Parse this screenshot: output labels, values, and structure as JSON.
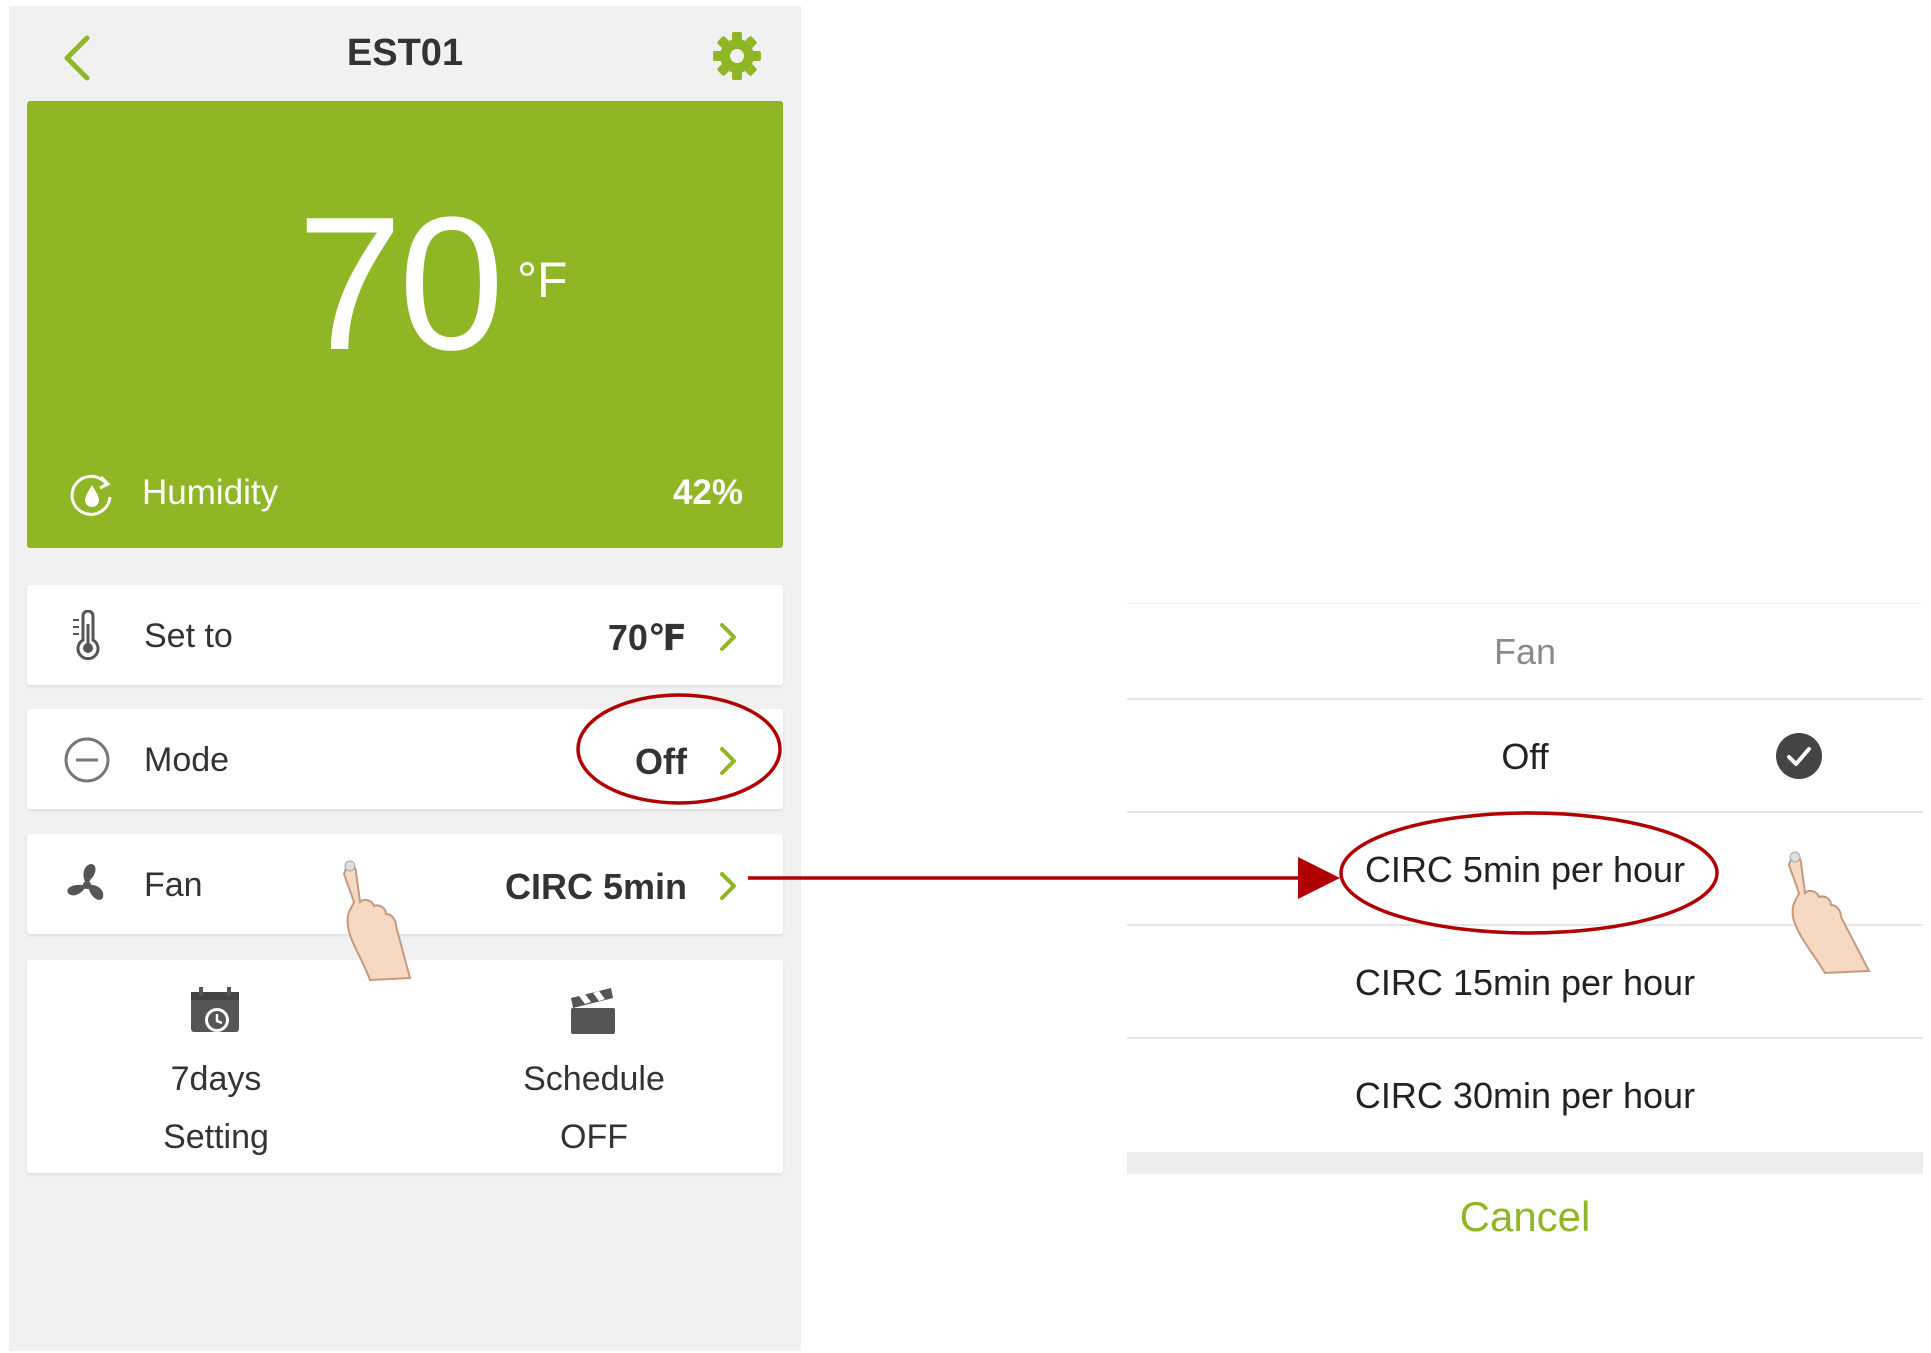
{
  "header": {
    "title": "EST01",
    "back_icon": "chevron-left-icon",
    "settings_icon": "gear-icon"
  },
  "thermostat": {
    "temperature": "70",
    "unit": "°F",
    "humidity_label": "Humidity",
    "humidity_value": "42%"
  },
  "rows": {
    "set_to": {
      "label": "Set to",
      "value": "70℉"
    },
    "mode": {
      "label": "Mode",
      "value": "Off"
    },
    "fan": {
      "label": "Fan",
      "value": "CIRC 5min"
    }
  },
  "tiles": {
    "seven_days": {
      "line1": "7days",
      "line2": "Setting"
    },
    "schedule": {
      "line1": "Schedule",
      "line2": "OFF"
    }
  },
  "fan_sheet": {
    "title": "Fan",
    "options": [
      "Off",
      "CIRC 5min per hour",
      "CIRC 15min per hour",
      "CIRC 30min per hour"
    ],
    "selected": "Off",
    "cancel_label": "Cancel"
  },
  "colors": {
    "accent": "#8fb625",
    "annotation": "#b00000",
    "background": "#f1f1f1"
  }
}
